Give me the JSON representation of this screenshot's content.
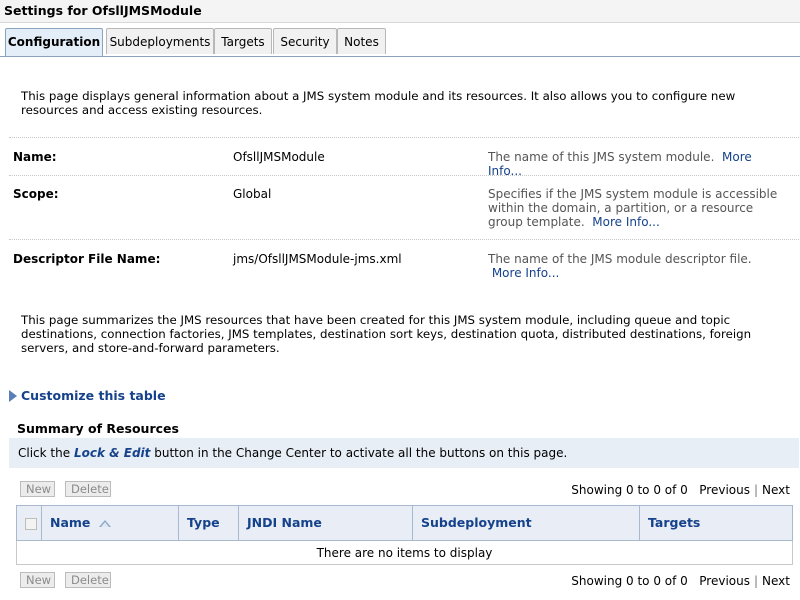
{
  "header": {
    "title": "Settings for OfsllJMSModule"
  },
  "tabs": [
    "Configuration",
    "Subdeployments",
    "Targets",
    "Security",
    "Notes"
  ],
  "intro": "This page displays general information about a JMS system module and its resources. It also allows you to configure new resources and access existing resources.",
  "fields": {
    "name": {
      "label": "Name:",
      "value": "OfsllJMSModule",
      "help": "The name of this JMS system module.",
      "more": "More Info..."
    },
    "scope": {
      "label": "Scope:",
      "value": "Global",
      "help": "Specifies if the JMS system module is accessible within the domain, a partition, or a resource group template.",
      "more": "More Info..."
    },
    "descriptor": {
      "label": "Descriptor File Name:",
      "value": "jms/OfsllJMSModule-jms.xml",
      "help": "The name of the JMS module descriptor file.",
      "more": "More Info..."
    }
  },
  "summary_para": "This page summarizes the JMS resources that have been created for this JMS system module, including queue and topic destinations, connection factories, JMS templates, destination sort keys, destination quota, distributed destinations, foreign servers, and store-and-forward parameters.",
  "customize": "Customize this table",
  "summary_title": "Summary of Resources",
  "lock": {
    "pre": "Click the",
    "strong": "Lock & Edit",
    "post": "button in the Change Center to activate all the buttons on this page."
  },
  "buttons": {
    "new": "New",
    "delete": "Delete"
  },
  "pager": {
    "showing": "Showing 0 to 0 of 0",
    "previous": "Previous",
    "sep": "|",
    "next": "Next"
  },
  "table": {
    "columns": [
      "Name",
      "Type",
      "JNDI Name",
      "Subdeployment",
      "Targets"
    ],
    "empty": "There are no items to display"
  }
}
